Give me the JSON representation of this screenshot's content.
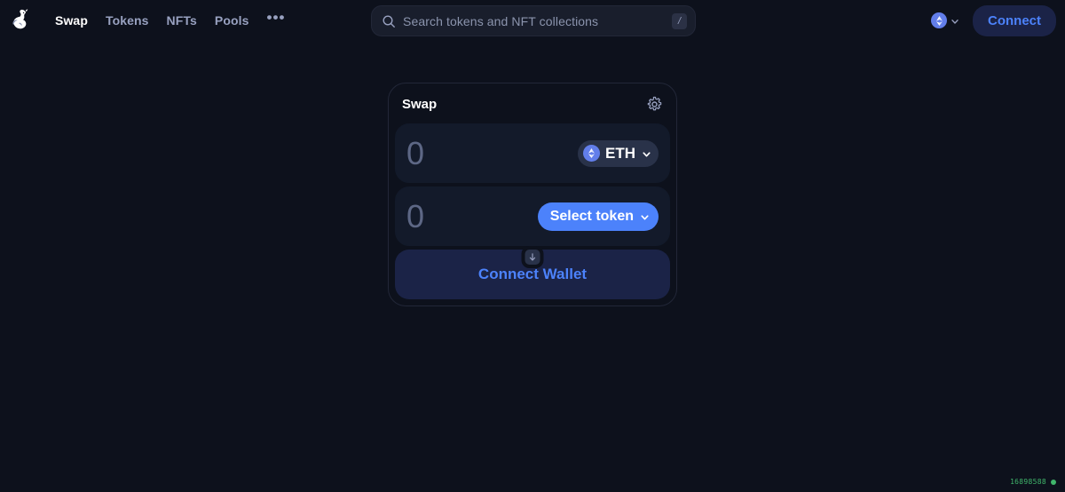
{
  "header": {
    "logo_icon": "uniswap-unicorn-logo",
    "nav_items": [
      {
        "label": "Swap",
        "active": true
      },
      {
        "label": "Tokens",
        "active": false
      },
      {
        "label": "NFTs",
        "active": false
      },
      {
        "label": "Pools",
        "active": false
      }
    ],
    "more_label": "•••",
    "search": {
      "placeholder": "Search tokens and NFT collections",
      "value": "",
      "shortcut_key": "/",
      "icon": "search-icon"
    },
    "chain": {
      "name": "Ethereum",
      "icon": "eth-logo-icon",
      "chevron": "chevron-down-icon"
    },
    "connect_label": "Connect"
  },
  "swap": {
    "title": "Swap",
    "settings_icon": "gear-icon",
    "input_field": {
      "amount": "0",
      "placeholder": "0",
      "token_symbol": "ETH",
      "token_icon": "eth-logo-icon",
      "chevron": "chevron-down-icon"
    },
    "switch_icon": "arrow-down-icon",
    "output_field": {
      "amount": "0",
      "placeholder": "0",
      "token_symbol": "Select token",
      "chevron": "chevron-down-icon"
    },
    "cta_label": "Connect Wallet"
  },
  "status": {
    "block_number": "16898588",
    "indicator": "live-dot"
  },
  "colors": {
    "page_bg": "#0d111c",
    "panel_bg": "#131a2a",
    "accent_blue": "#4c82fb",
    "cta_bg": "#1b2347",
    "text_muted": "#98a1c0",
    "status_green": "#40b66b"
  }
}
